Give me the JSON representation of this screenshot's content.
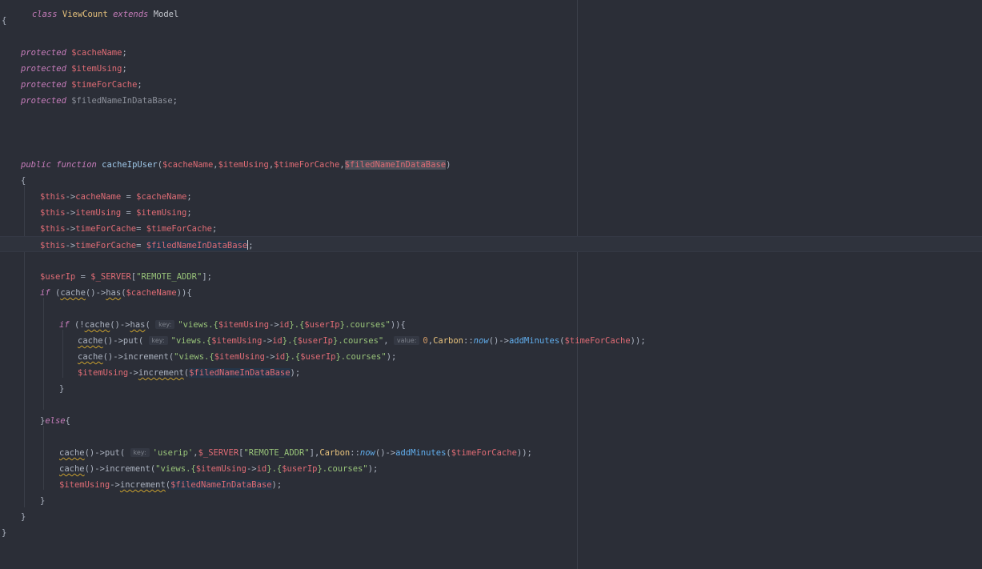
{
  "editor": {
    "lines": {
      "l1": {
        "kw_class": "class",
        "name": "ViewCount",
        "kw_extends": "extends",
        "parent": "Model"
      },
      "l2": {
        "brace": "{"
      },
      "l3": {
        "kw": "protected",
        "var": "$cacheName",
        "end": ";"
      },
      "l4": {
        "kw": "protected",
        "var": "$itemUsing",
        "end": ";"
      },
      "l5": {
        "kw": "protected",
        "var": "$timeForCache",
        "end": ";"
      },
      "l6": {
        "kw": "protected",
        "var": "$filedNameInDataBase",
        "end": ";"
      },
      "l7": {
        "kw_public": "public",
        "kw_function": "function",
        "fn": "cacheIpUser",
        "open": "(",
        "p1": "$cacheName",
        "c1": ",",
        "p2": "$itemUsing",
        "c2": ",",
        "p3": "$timeForCache",
        "c3": ",",
        "p4": "$filedNameInDataBase",
        "close": ")"
      },
      "l8": {
        "brace": "{"
      },
      "l9": {
        "this": "$this",
        "arrow": "->",
        "prop": "cacheName",
        "eq": " = ",
        "val": "$cacheName",
        "end": ";"
      },
      "l10": {
        "this": "$this",
        "arrow": "->",
        "prop": "itemUsing",
        "eq": " = ",
        "val": "$itemUsing",
        "end": ";"
      },
      "l11": {
        "this": "$this",
        "arrow": "->",
        "prop": "timeForCache",
        "eq": "= ",
        "val": "$timeForCache",
        "end": ";"
      },
      "l12": {
        "this": "$this",
        "arrow": "->",
        "prop": "timeForCache",
        "eq": "= ",
        "val": "$filedNameInDataBase",
        "end": ";"
      },
      "l13": {
        "var": "$userIp",
        "eq": " = ",
        "server": "$_SERVER",
        "open": "[",
        "str": "\"REMOTE_ADDR\"",
        "close": "];"
      },
      "l14": {
        "kw": "if",
        "open": " (",
        "fn": "cache",
        "mid": "()->",
        "fn2": "has",
        "p": "(",
        "var": "$cacheName",
        "close": ")){"
      },
      "l15": {
        "kw": "if",
        "open": " (!",
        "fn": "cache",
        "mid": "()->",
        "fn2": "has",
        "p": "( ",
        "hint": "key:",
        "str1": "\"views.{",
        "v1": "$itemUsing",
        "arr": "->",
        "prop": "id",
        "str2": "}.{",
        "v2": "$userIp",
        "str3": "}.courses\"",
        "close": ")){"
      },
      "l16": {
        "fn": "cache",
        "mid": "()->",
        "fn2": "put",
        "p": "( ",
        "hint": "key:",
        "str1": "\"views.{",
        "v1": "$itemUsing",
        "arr": "->",
        "prop": "id",
        "str2": "}.{",
        "v2": "$userIp",
        "str3": "}.courses\"",
        "comma": ", ",
        "hint2": "value:",
        "num": "0",
        "c2": ",",
        "carbon": "Carbon",
        "dc": "::",
        "now": "now",
        "mid2": "()->",
        "add": "addMinutes",
        "p2": "(",
        "v3": "$timeForCache",
        "close": "));"
      },
      "l17": {
        "fn": "cache",
        "mid": "()->",
        "fn2": "increment",
        "p": "(",
        "str1": "\"views.{",
        "v1": "$itemUsing",
        "arr": "->",
        "prop": "id",
        "str2": "}.{",
        "v2": "$userIp",
        "str3": "}.courses\"",
        "close": ");"
      },
      "l18": {
        "var": "$itemUsing",
        "arr": "->",
        "fn": "increment",
        "p": "(",
        "v": "$filedNameInDataBase",
        "close": ");"
      },
      "l19": {
        "brace": "}"
      },
      "l20": {
        "close": "}",
        "kw": "else",
        "open": "{"
      },
      "l21": {
        "fn": "cache",
        "mid": "()->",
        "fn2": "put",
        "p": "( ",
        "hint": "key:",
        "str": "'userip'",
        "c1": ",",
        "server": "$_SERVER",
        "b1": "[",
        "str2": "\"REMOTE_ADDR\"",
        "b2": "],",
        "carbon": "Carbon",
        "dc": "::",
        "now": "now",
        "mid2": "()->",
        "add": "addMinutes",
        "p2": "(",
        "v": "$timeForCache",
        "close": "));"
      },
      "l22": {
        "fn": "cache",
        "mid": "()->",
        "fn2": "increment",
        "p": "(",
        "str1": "\"views.{",
        "v1": "$itemUsing",
        "arr": "->",
        "prop": "id",
        "str2": "}.{",
        "v2": "$userIp",
        "str3": "}.courses\"",
        "close": ");"
      },
      "l23": {
        "var": "$itemUsing",
        "arr": "->",
        "fn": "increment",
        "p": "(",
        "v": "$filedNameInDataBase",
        "close": ");"
      },
      "l24": {
        "brace": "}"
      },
      "l25": {
        "brace": "}"
      },
      "l26": {
        "brace": "}"
      }
    }
  },
  "colors": {
    "background": "#2b2e37",
    "keyword": "#c77dbb",
    "class_name": "#e5c07b",
    "variable": "#e06c75",
    "string": "#98c379",
    "function": "#61afef"
  }
}
